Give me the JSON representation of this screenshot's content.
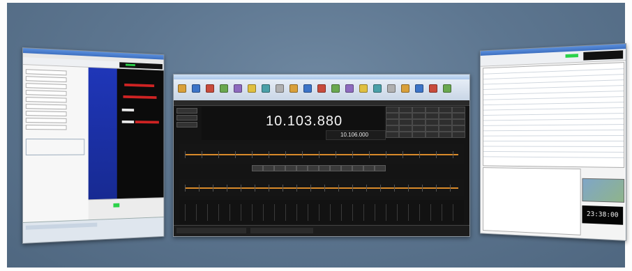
{
  "center_window": {
    "frequency_main": "10.103.880",
    "frequency_sub": "10.106.000",
    "toolbar_buttons": 20
  },
  "right_window": {
    "clock": "23:38:00"
  },
  "colors": {
    "backdrop": "#5f7892",
    "center_bg": "#141414",
    "accent_orange": "#d98a2a",
    "left_blue": "#1b2fa6",
    "left_red": "#cf2323",
    "title_blue": "#4a7fd0",
    "green_led": "#2bd24a"
  },
  "icons": [
    "window-app-icon",
    "toolbar-icons",
    "clock-display"
  ]
}
